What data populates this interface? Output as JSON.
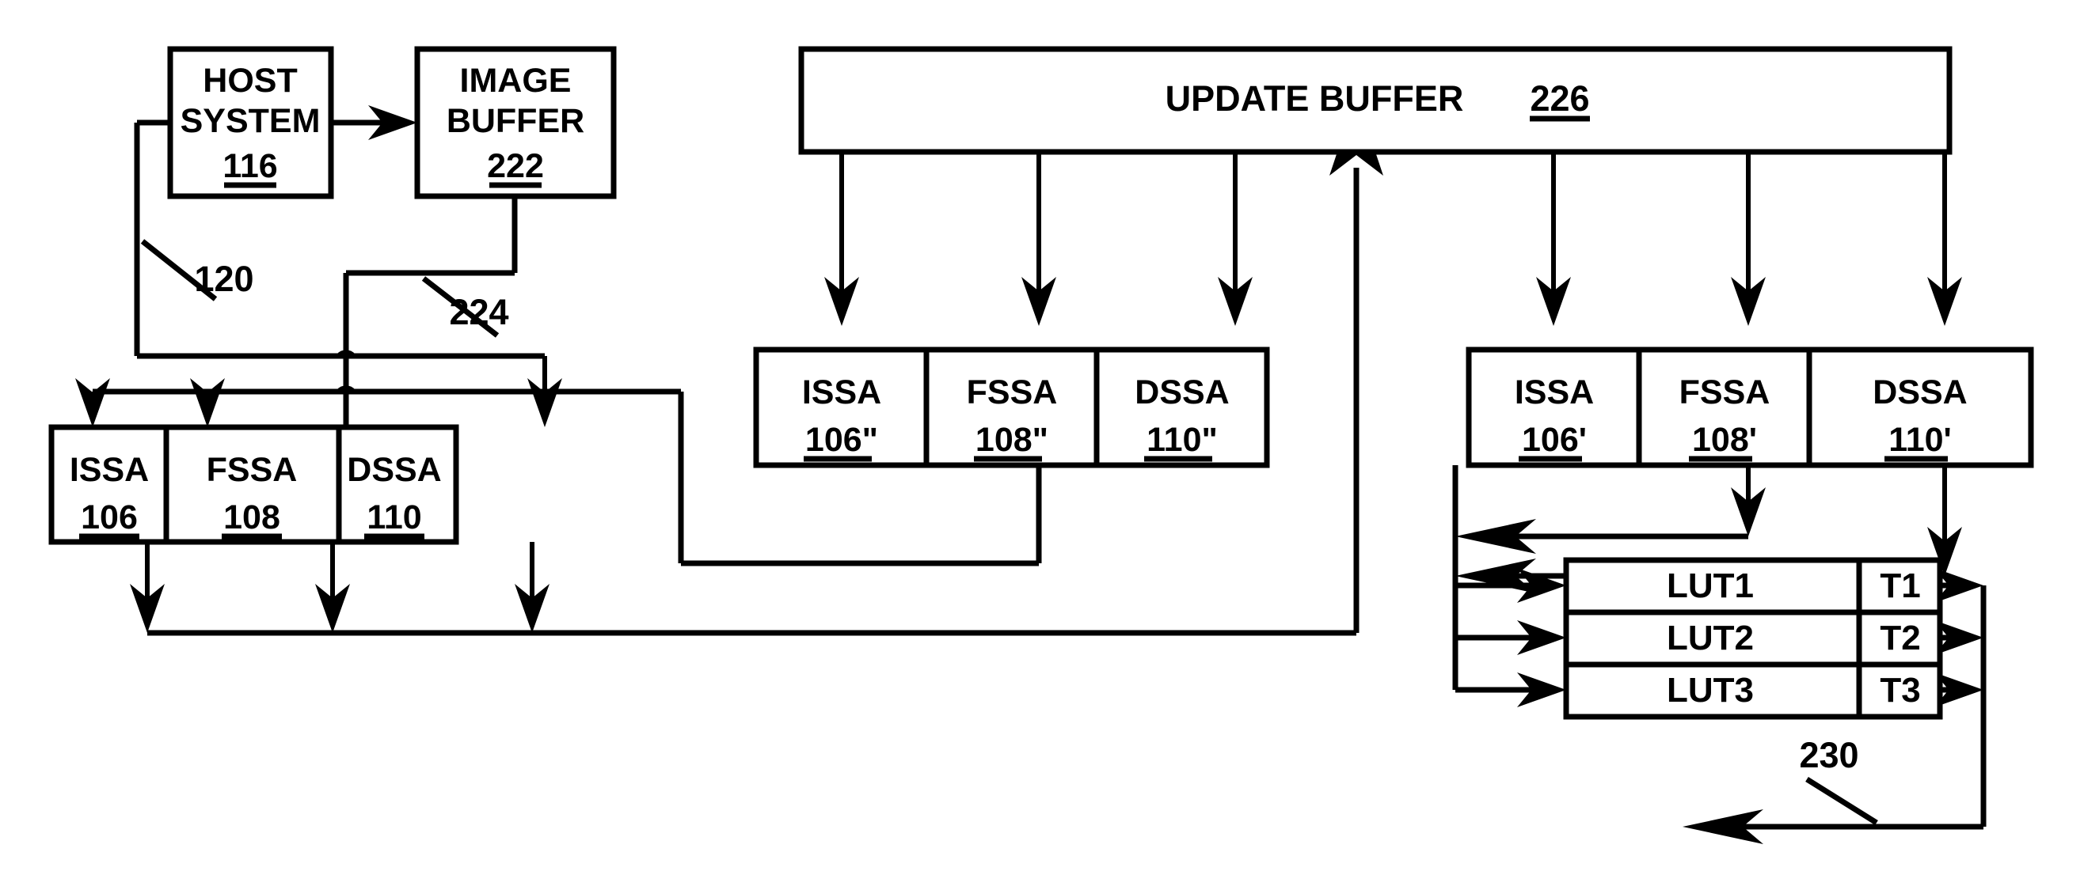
{
  "figure": {
    "type": "patent-block-diagram",
    "background": "#ffffff",
    "line_color": "#000000"
  },
  "blocks": {
    "host_system": {
      "line1": "HOST",
      "line2": "SYSTEM",
      "ref": "116"
    },
    "image_buffer": {
      "line1": "IMAGE",
      "line2": "BUFFER",
      "ref": "222"
    },
    "update_buffer": {
      "title": "UPDATE  BUFFER ",
      "ref": "226"
    }
  },
  "groups": {
    "base": {
      "cells": [
        {
          "name": "ISSA",
          "ref": "106"
        },
        {
          "name": "FSSA",
          "ref": "108"
        },
        {
          "name": "DSSA",
          "ref": "110"
        }
      ]
    },
    "double_prime": {
      "cells": [
        {
          "name": "ISSA",
          "ref": "106\""
        },
        {
          "name": "FSSA",
          "ref": "108\""
        },
        {
          "name": "DSSA",
          "ref": "110\""
        }
      ]
    },
    "single_prime": {
      "cells": [
        {
          "name": "ISSA",
          "ref": "106'"
        },
        {
          "name": "FSSA",
          "ref": "108'"
        },
        {
          "name": "DSSA",
          "ref": "110'"
        }
      ]
    }
  },
  "lut_table": {
    "rows": [
      {
        "lut": "LUT1",
        "t": "T1"
      },
      {
        "lut": "LUT2",
        "t": "T2"
      },
      {
        "lut": "LUT3",
        "t": "T3"
      }
    ]
  },
  "lead_labels": {
    "l120": "120",
    "l224": "224",
    "l230": "230"
  }
}
